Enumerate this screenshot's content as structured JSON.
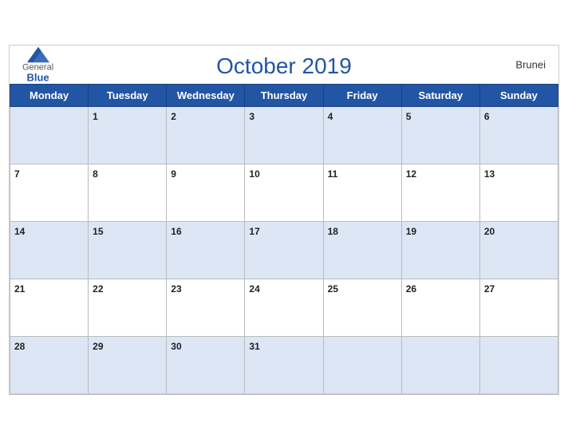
{
  "header": {
    "logo_general": "General",
    "logo_blue": "Blue",
    "title": "October 2019",
    "country": "Brunei"
  },
  "weekdays": [
    "Monday",
    "Tuesday",
    "Wednesday",
    "Thursday",
    "Friday",
    "Saturday",
    "Sunday"
  ],
  "weeks": [
    [
      null,
      1,
      2,
      3,
      4,
      5,
      6
    ],
    [
      7,
      8,
      9,
      10,
      11,
      12,
      13
    ],
    [
      14,
      15,
      16,
      17,
      18,
      19,
      20
    ],
    [
      21,
      22,
      23,
      24,
      25,
      26,
      27
    ],
    [
      28,
      29,
      30,
      31,
      null,
      null,
      null
    ]
  ]
}
